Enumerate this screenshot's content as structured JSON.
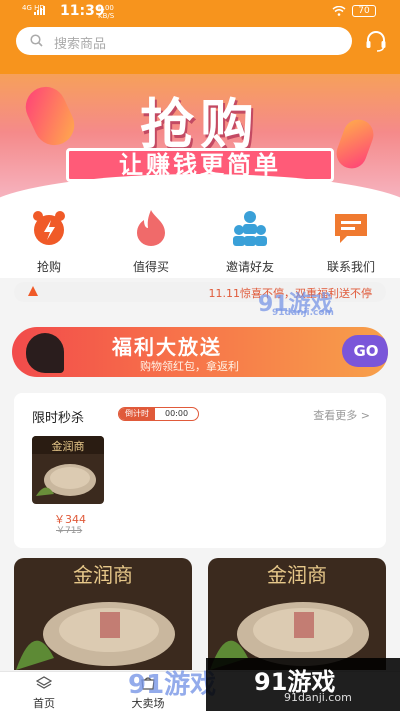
{
  "status_bar": {
    "network": "4G HD",
    "time": "11:39",
    "speed": "0.00",
    "speed_unit": "KB/S",
    "battery": "70"
  },
  "header": {
    "search_placeholder": "搜索商品",
    "search_icon": "search-icon",
    "service_icon": "headset-icon"
  },
  "banner": {
    "headline": "抢购",
    "subline": "让赚钱更简单"
  },
  "quick_menu": [
    {
      "label": "抢购",
      "icon": "alarm-clock-icon",
      "color": "#f05a28"
    },
    {
      "label": "值得买",
      "icon": "flame-icon",
      "color": "#f06a6a"
    },
    {
      "label": "邀请好友",
      "icon": "people-icon",
      "color": "#3aa0d8"
    },
    {
      "label": "联系我们",
      "icon": "chat-bubble-icon",
      "color": "#f07a30"
    }
  ],
  "notice": {
    "text": "11.11惊喜不停，双重福利送不停"
  },
  "promo": {
    "title": "福利大放送",
    "subtitle": "购物领红包，拿返利",
    "go_label": "GO"
  },
  "flash_sale": {
    "title": "限时秒杀",
    "countdown_label": "倒计时",
    "countdown_value": "00:00",
    "more_label": "查看更多 >",
    "product": {
      "brand_text": "金润商",
      "price": "￥344",
      "original_price": "￥715"
    }
  },
  "products": [
    {
      "brand_text": "金润商"
    },
    {
      "brand_text": "金润商"
    }
  ],
  "tab_bar": [
    {
      "label": "首页",
      "icon": "home-icon"
    },
    {
      "label": "大卖场",
      "icon": "shop-icon"
    }
  ],
  "watermarks": {
    "large_text": "91游戏",
    "small_text": "91danji.com",
    "badge_text": "91游戏",
    "badge_small": "91danji.com"
  },
  "colors": {
    "brand_orange": "#f7941d",
    "accent_red": "#e05a3a"
  }
}
